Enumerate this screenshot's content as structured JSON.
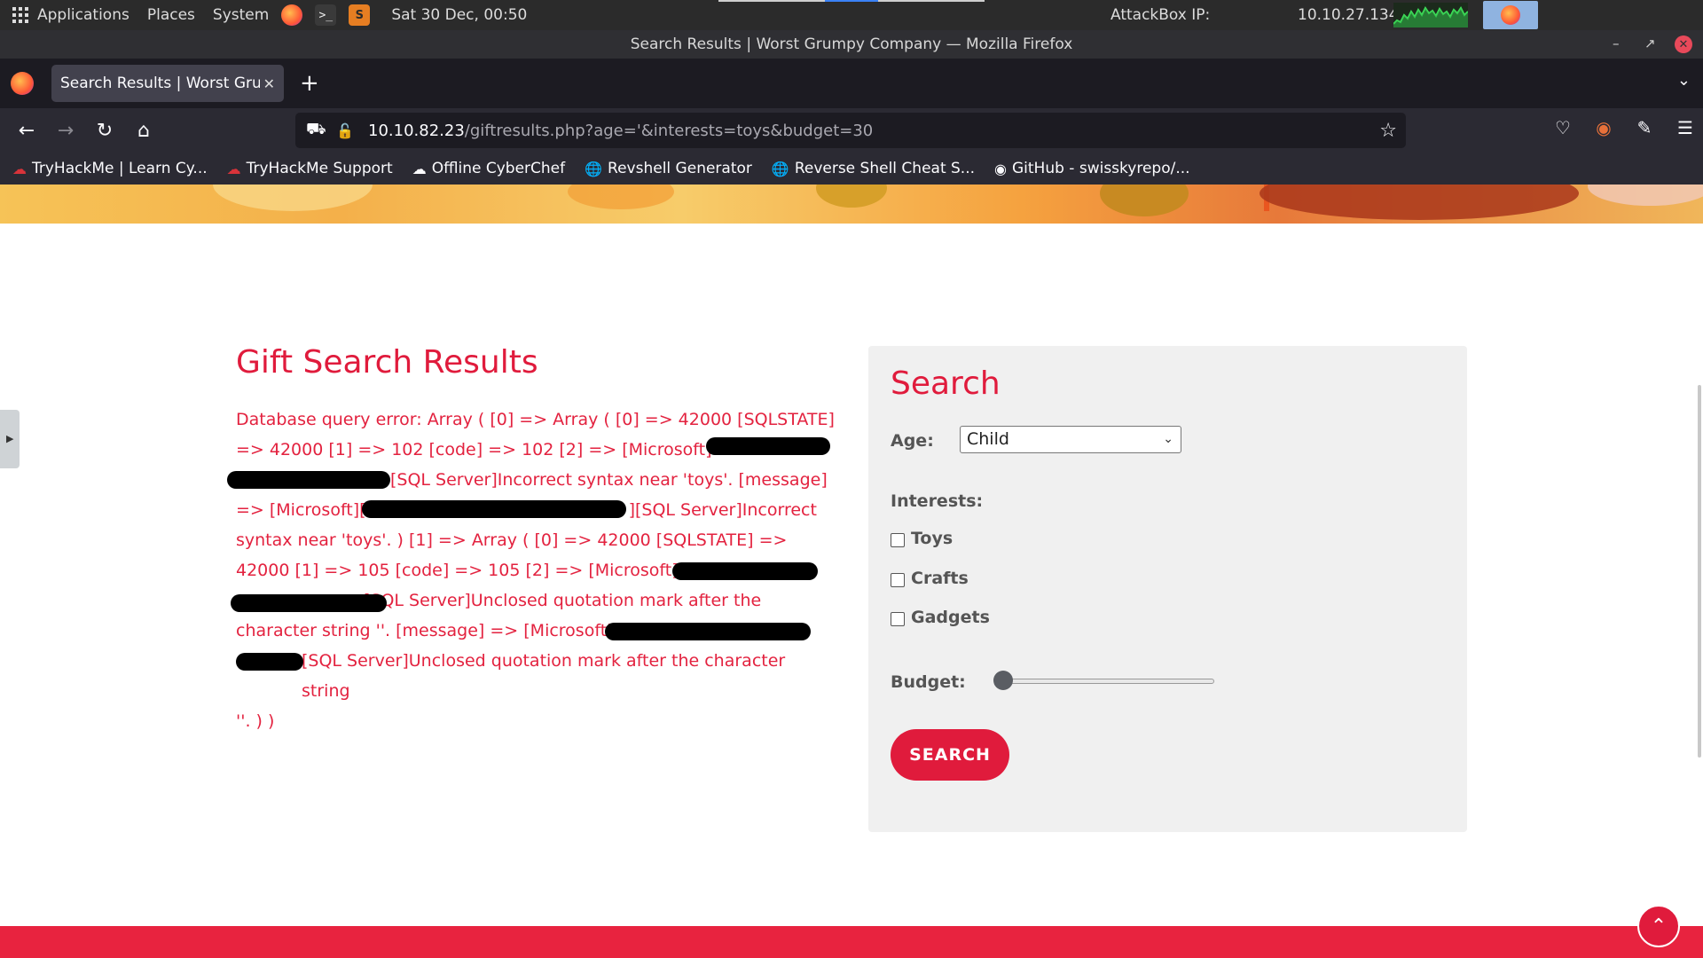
{
  "os_panel": {
    "applications": "Applications",
    "places": "Places",
    "system": "System",
    "clock": "Sat 30 Dec, 00:50",
    "attackbox_label": "AttackBox IP:",
    "attackbox_ip": "10.10.27.134"
  },
  "window": {
    "title": "Search Results | Worst Grumpy Company — Mozilla Firefox"
  },
  "tab": {
    "title": "Search Results | Worst Grumpy Company"
  },
  "urlbar": {
    "host": "10.10.82.23",
    "path": "/giftresults.php?age='&interests=toys&budget=30"
  },
  "bookmarks": [
    {
      "label": "TryHackMe | Learn Cy...",
      "icon": "tryhackme-icon"
    },
    {
      "label": "TryHackMe Support",
      "icon": "tryhackme-icon"
    },
    {
      "label": "Offline CyberChef",
      "icon": "chef-hat-icon"
    },
    {
      "label": "Revshell Generator",
      "icon": "globe-icon"
    },
    {
      "label": "Reverse Shell Cheat S...",
      "icon": "globe-icon"
    },
    {
      "label": "GitHub - swisskyrepo/...",
      "icon": "github-icon"
    }
  ],
  "results": {
    "title": "Gift Search Results",
    "error_lines": [
      "Database query error: Array ( [0] => Array ( [0] => 42000 [SQLSTATE]",
      "=> 42000 [1] => 102 [code] => 102 [2] => [Microsoft]",
      "[SQL Server]Incorrect syntax near 'toys'. [message]",
      "=> [Microsoft][",
      "][SQL Server]Incorrect",
      "syntax near 'toys'. ) [1] => Array ( [0] => 42000 [SQLSTATE] =>",
      "42000 [1] => 105 [code] => 105 [2] => [Microsoft]",
      "[SQL Server]Unclosed quotation mark after the",
      "character string ''. [message] => [Microsoft]",
      "[SQL Server]Unclosed quotation mark after the character string",
      "''. ) )"
    ]
  },
  "search": {
    "title": "Search",
    "age_label": "Age:",
    "age_value": "Child",
    "interests_label": "Interests:",
    "interests": [
      {
        "label": "Toys",
        "checked": false
      },
      {
        "label": "Crafts",
        "checked": false
      },
      {
        "label": "Gadgets",
        "checked": false
      }
    ],
    "budget_label": "Budget:",
    "budget_level": 0,
    "button": "SEARCH"
  },
  "colors": {
    "accent": "#e01b3c",
    "footer": "#e8233f"
  }
}
